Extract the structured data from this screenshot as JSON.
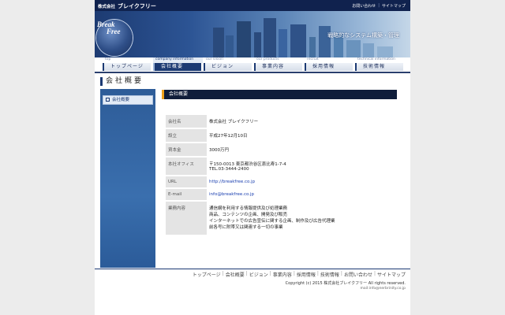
{
  "header": {
    "company_prefix": "株式会社",
    "company_name": "ブレイクフリー",
    "links": [
      "お問い合わせ",
      "サイトマップ"
    ]
  },
  "hero": {
    "logo_line1": "Break",
    "logo_line2": "Free",
    "tagline": "戦略的なシステム構築・管理"
  },
  "nav": [
    {
      "en": "top",
      "ja": "トップページ",
      "active": false
    },
    {
      "en": "company information",
      "ja": "会社概要",
      "active": true
    },
    {
      "en": "our vision",
      "ja": "ビジョン",
      "active": false
    },
    {
      "en": "our products",
      "ja": "事業内容",
      "active": false
    },
    {
      "en": "recruit",
      "ja": "採用情報",
      "active": false
    },
    {
      "en": "technical information",
      "ja": "技術情報",
      "active": false
    }
  ],
  "page_title": "会社概要",
  "sidebar": {
    "item": "会社概要"
  },
  "main": {
    "heading": "会社概要",
    "rows": [
      {
        "key": "会社名",
        "value": [
          "株式会社 ブレイクフリー"
        ]
      },
      {
        "key": "設立",
        "value": [
          "平成27年12月10日"
        ]
      },
      {
        "key": "資本金",
        "value": [
          "3000万円"
        ]
      },
      {
        "key": "本社オフィス",
        "value": [
          "〒150-0013 東京都渋谷区恵比寿1-7-4",
          "TEL.03-3444-2400"
        ]
      },
      {
        "key": "URL",
        "value": [
          "http://breakfree.co.jp"
        ],
        "link": true
      },
      {
        "key": "E-mail",
        "value": [
          "info@breakfree.co.jp"
        ],
        "link": true
      },
      {
        "key": "業務内容",
        "value": [
          "通信網を利用する情報提供及び処理業務",
          "商品、コンテンツの企画、開発及び販売",
          "インターネットでの広告宣伝に関する企画、制作及び広告代理業",
          "前各号に附帯又は関連する一切の事業"
        ]
      }
    ]
  },
  "footer": {
    "links": [
      "トップページ",
      "会社概要",
      "ビジョン",
      "事業内容",
      "採用情報",
      "技術情報",
      "お問い合わせ",
      "サイトマップ"
    ],
    "copyright": "Copyright (c) 2015 株式会社ブレイクフリー All rights reserved.",
    "mail": "mail:info@nerbrinity.co.jp"
  },
  "colors": {
    "navy": "#10224e",
    "accent": "#f0a11a",
    "link": "#1a3fb0"
  }
}
